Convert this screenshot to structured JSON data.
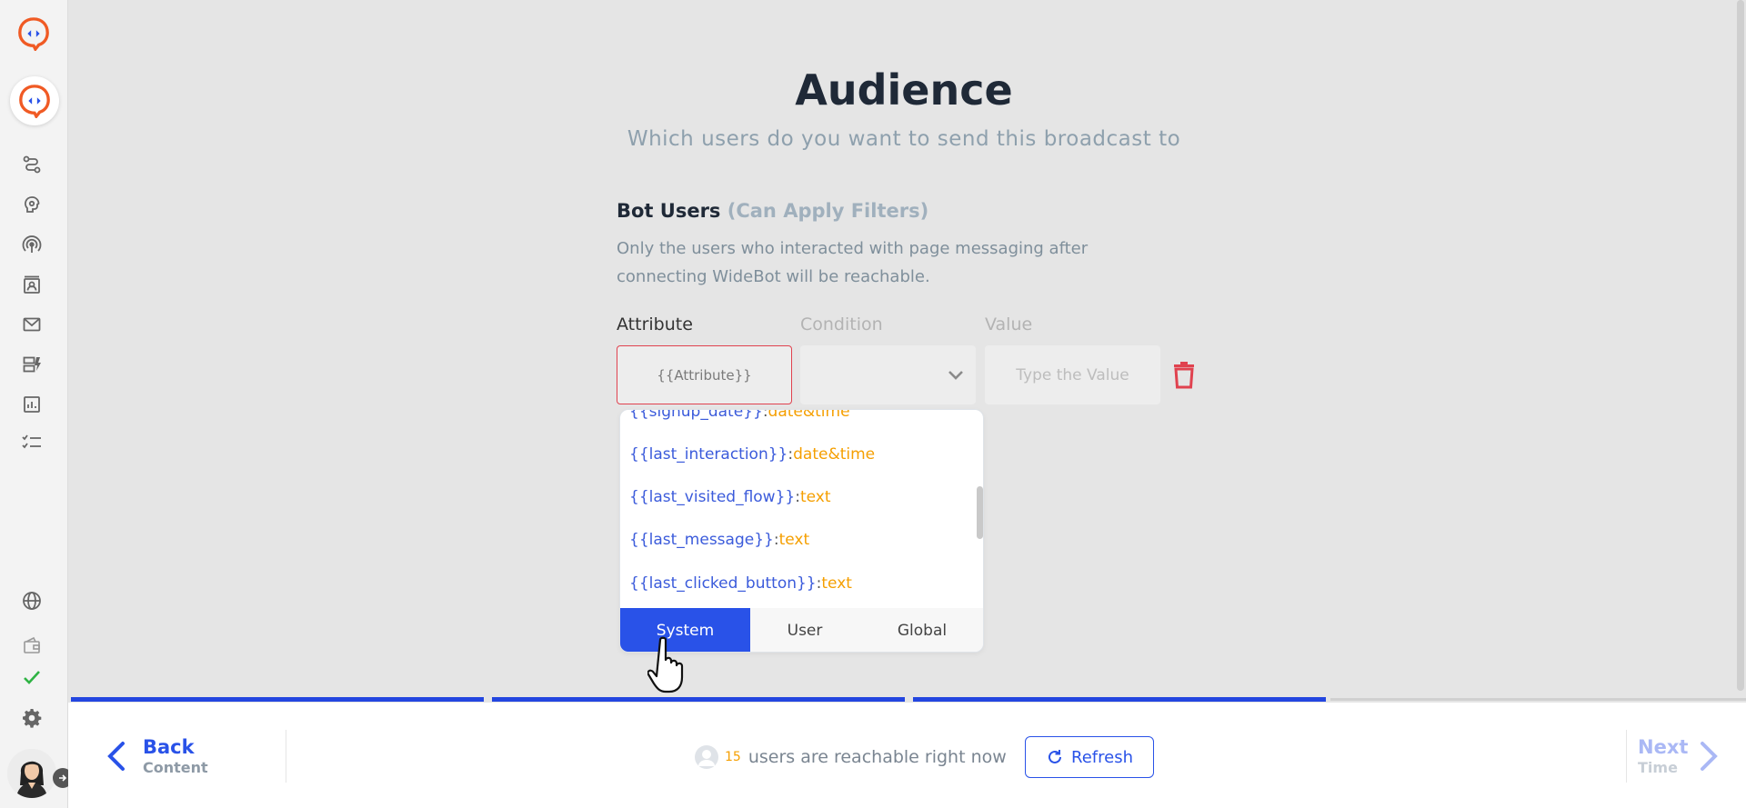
{
  "header": {
    "title": "Audience",
    "subtitle": "Which users do you want to send this broadcast to"
  },
  "section": {
    "title": "Bot Users",
    "hint": "(Can Apply Filters)",
    "description": "Only the users who interacted with page messaging after connecting WideBot will be reachable."
  },
  "filter": {
    "attribute_label": "Attribute",
    "condition_label": "Condition",
    "value_label": "Value",
    "attribute_value": "{{Attribute}}",
    "value_placeholder": "Type the Value"
  },
  "dropdown": {
    "items": [
      {
        "name": "{{signup_date}}",
        "sep": ":",
        "type": "date&time"
      },
      {
        "name": "{{last_interaction}}",
        "sep": ":",
        "type": "date&time"
      },
      {
        "name": "{{last_visited_flow}}",
        "sep": ":",
        "type": "text"
      },
      {
        "name": "{{last_message}}",
        "sep": ":",
        "type": "text"
      },
      {
        "name": "{{last_clicked_button}}",
        "sep": ":",
        "type": "text"
      }
    ],
    "tabs": [
      "System",
      "User",
      "Global"
    ],
    "active_tab": "System"
  },
  "footer": {
    "back_label": "Back",
    "back_sub": "Content",
    "reach_count": "15",
    "reach_text": "users are reachable right now",
    "refresh_label": "Refresh",
    "next_label": "Next",
    "next_sub": "Time"
  },
  "progress": {
    "steps_total": 4,
    "steps_done": 3
  },
  "colors": {
    "accent": "#2952e8",
    "brand_orange": "#f05a24",
    "danger": "#e0424f",
    "type_orange": "#f59f00",
    "success": "#2fb344"
  },
  "sidebar": {
    "icons": [
      "flows-icon",
      "brain-icon",
      "broadcast-icon",
      "contacts-icon",
      "inbox-icon",
      "integrations-icon",
      "analytics-icon",
      "tasks-icon",
      "globe-icon",
      "wallet-icon",
      "check-icon",
      "gear-icon"
    ]
  }
}
